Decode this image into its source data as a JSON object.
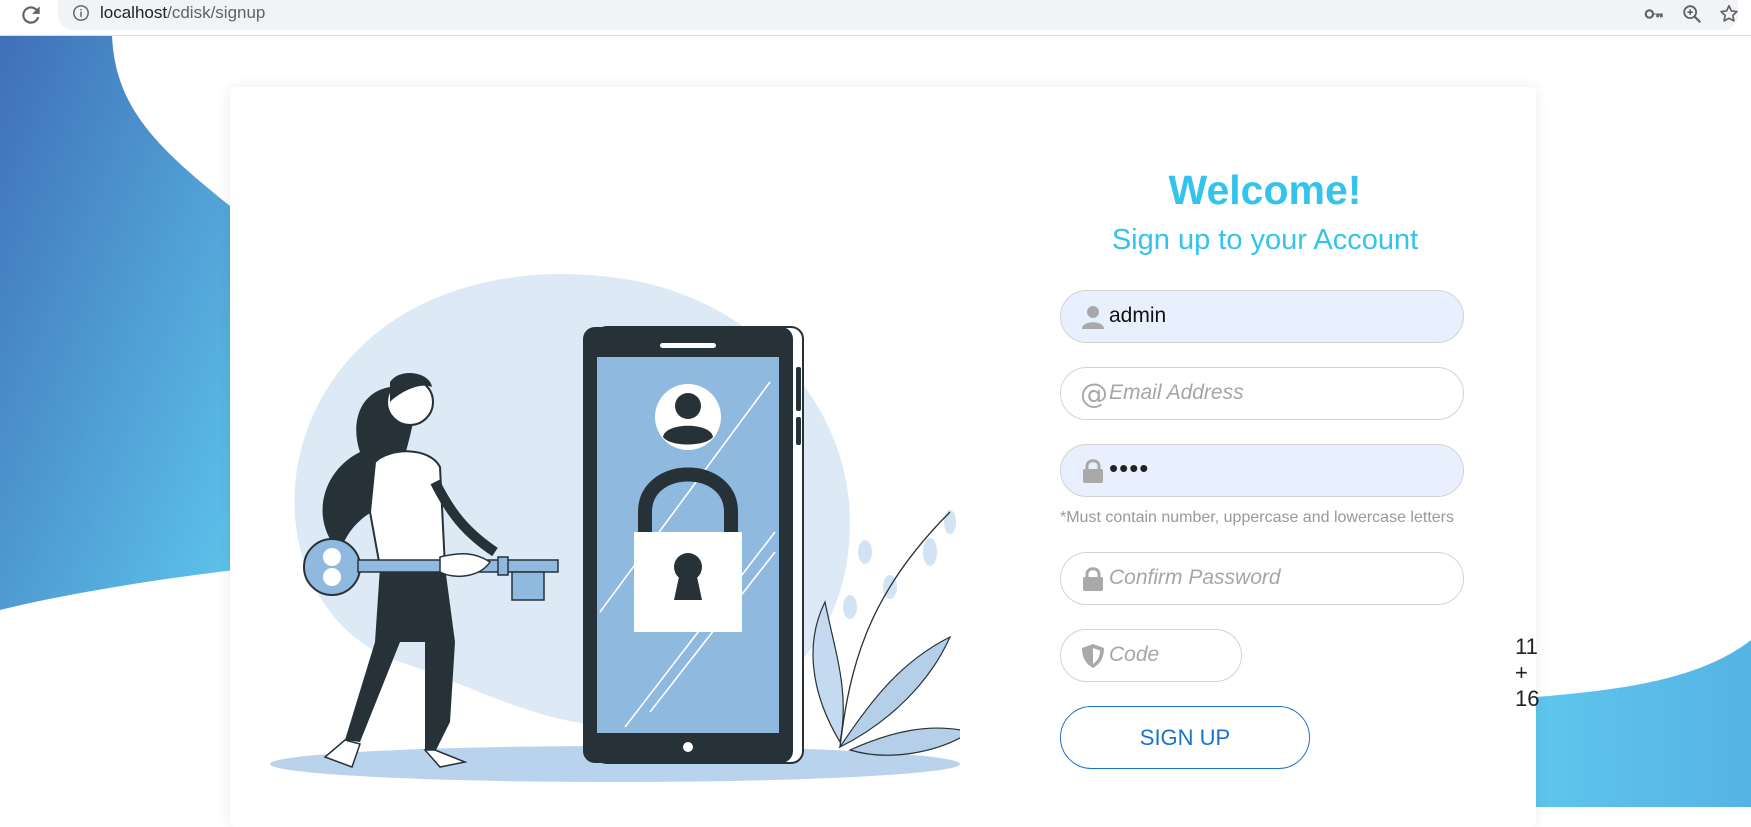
{
  "browser": {
    "url_host": "localhost",
    "url_path": "/cdisk/signup"
  },
  "form": {
    "welcome": "Welcome!",
    "subtitle": "Sign up to your Account",
    "username_value": "admin",
    "email_placeholder": "Email Address",
    "password_value": "••••",
    "password_hint": "*Must contain number, uppercase and lowercase letters",
    "confirm_placeholder": "Confirm Password",
    "code_placeholder": "Code",
    "captcha_question": "11 + 16",
    "signup_label": "SIGN UP"
  },
  "colors": {
    "accent": "#33c3eb",
    "button": "#1a73c9",
    "bg_gradient_start": "#3f72bb",
    "bg_gradient_end": "#5ec3ea"
  }
}
